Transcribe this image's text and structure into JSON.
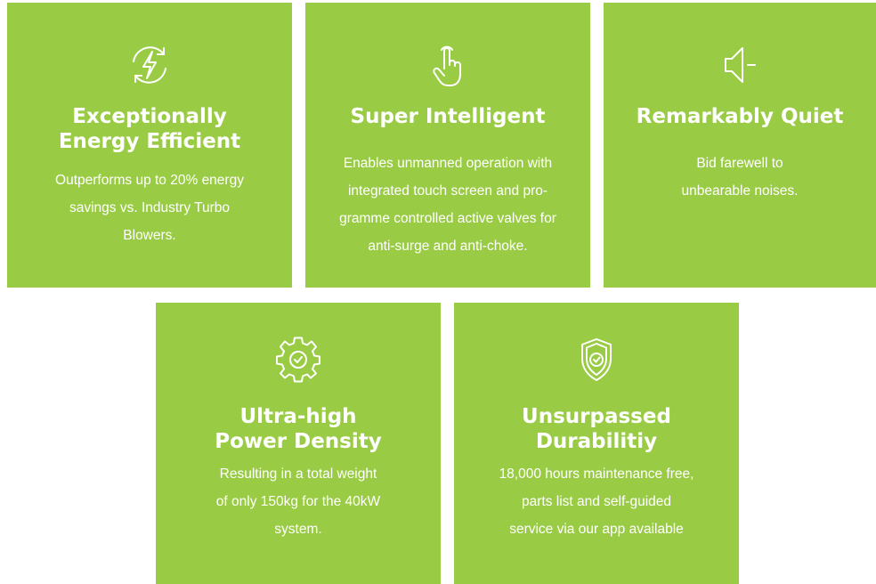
{
  "theme": {
    "card_color": "#99cc44",
    "text_color": "#ffffff"
  },
  "cards": [
    {
      "icon": "lightning-refresh-icon",
      "title_lines": [
        "Exceptionally",
        "Energy Efficient"
      ],
      "desc_lines": [
        "Outperforms up to 20% energy",
        "savings vs. Industry Turbo",
        "Blowers."
      ]
    },
    {
      "icon": "touch-hand-icon",
      "title_lines": [
        "Super Intelligent"
      ],
      "desc_lines": [
        "Enables unmanned operation with",
        "integrated touch screen and pro-",
        "gramme controlled active valves for",
        "anti-surge and anti-choke."
      ]
    },
    {
      "icon": "speaker-mute-icon",
      "title_lines": [
        "Remarkably Quiet"
      ],
      "desc_lines": [
        "Bid farewell to",
        "unbearable noises."
      ]
    },
    {
      "icon": "gear-check-icon",
      "title_lines": [
        "Ultra-high",
        "Power Density"
      ],
      "desc_lines": [
        "Resulting in a total weight",
        "of only 150kg for the 40kW",
        "system."
      ]
    },
    {
      "icon": "shield-check-icon",
      "title_lines": [
        "Unsurpassed",
        "Durabilitiy"
      ],
      "desc_lines": [
        "18,000 hours maintenance free,",
        "parts list and self-guided",
        "service via our app available"
      ]
    }
  ]
}
